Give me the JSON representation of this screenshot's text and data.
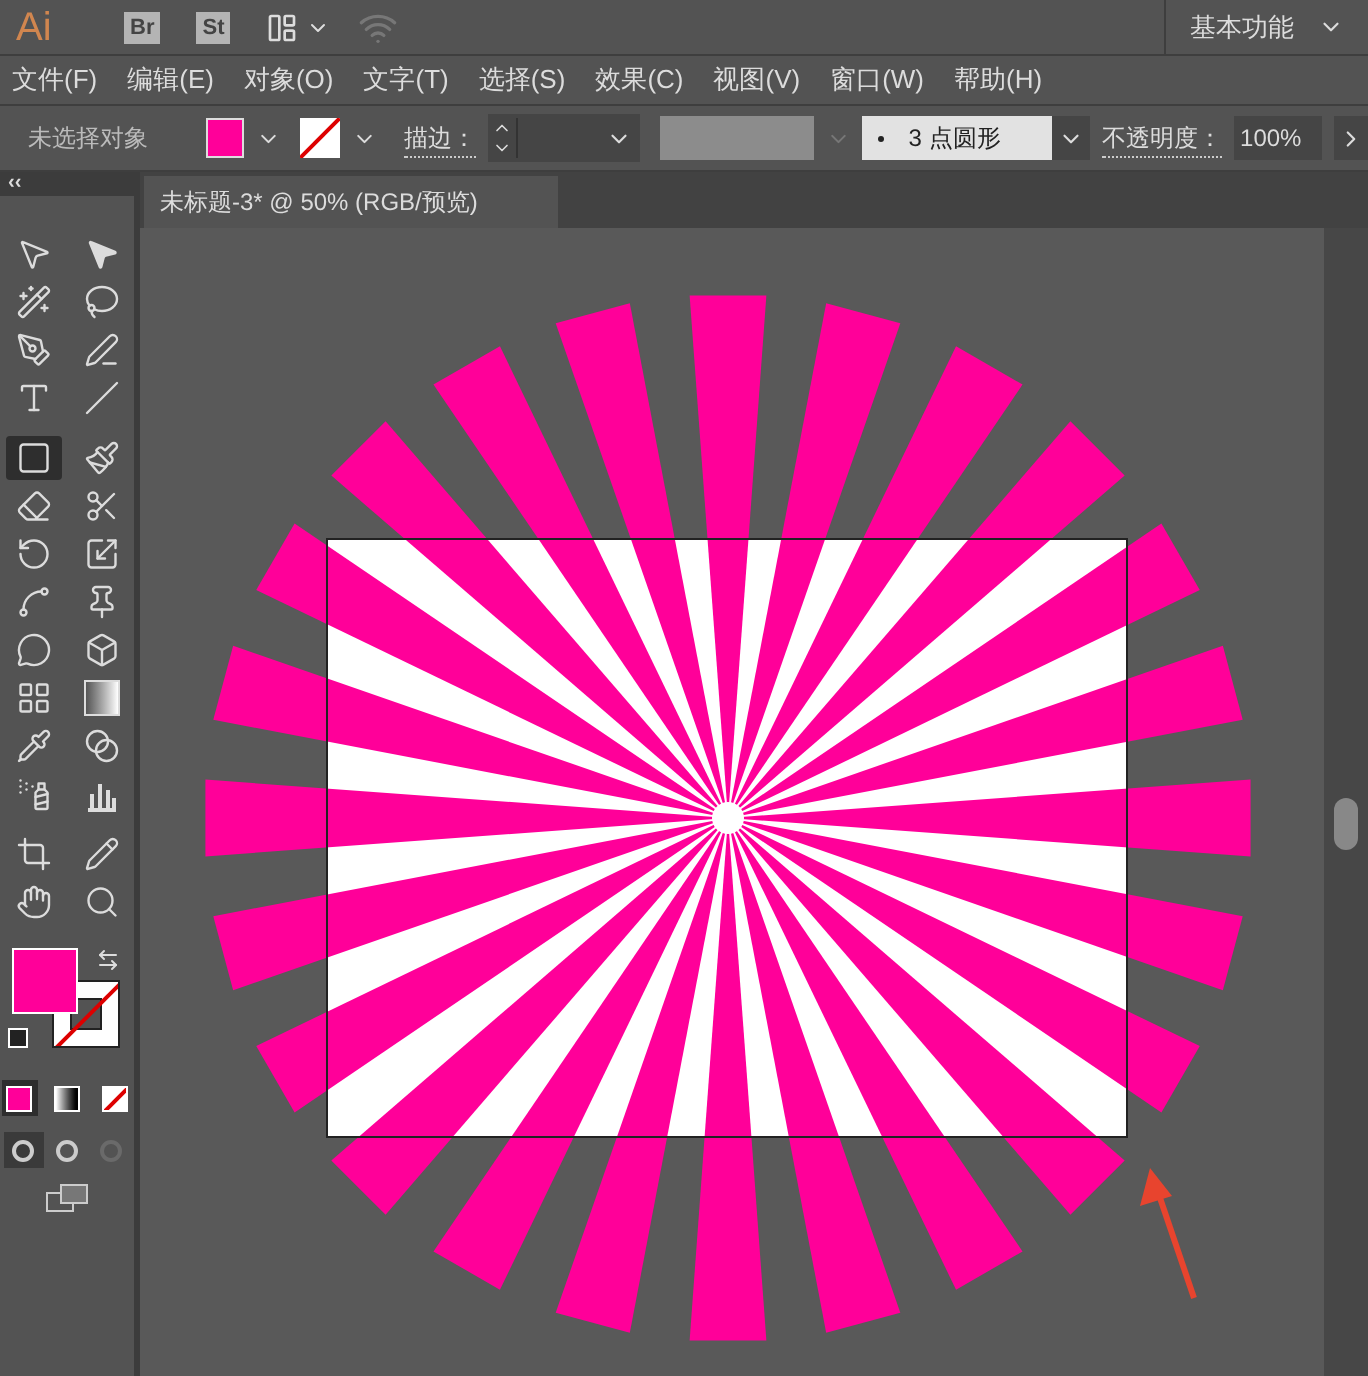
{
  "app": {
    "logo": "Ai",
    "bridge": "Br",
    "stock": "St",
    "workspace": "基本功能"
  },
  "menu": [
    "文件(F)",
    "编辑(E)",
    "对象(O)",
    "文字(T)",
    "选择(S)",
    "效果(C)",
    "视图(V)",
    "窗口(W)",
    "帮助(H)"
  ],
  "control_bar": {
    "selection": "未选择对象",
    "fill": {
      "color": "#ff0099"
    },
    "stroke_label": "描边：",
    "brush": "3 点圆形",
    "opacity_label": "不透明度：",
    "opacity": "100%"
  },
  "panel_collapse": "‹‹",
  "document_tab": {
    "title": "未标题-3* @ 50% (RGB/预览)",
    "selected": true
  },
  "tools": [
    {
      "kind": "select",
      "selected": false
    },
    {
      "kind": "direct-select",
      "selected": false
    },
    {
      "kind": "magic-wand",
      "selected": false
    },
    {
      "kind": "lasso",
      "selected": false
    },
    {
      "kind": "pen",
      "selected": false
    },
    {
      "kind": "curvature",
      "selected": false
    },
    {
      "kind": "type",
      "selected": false
    },
    {
      "kind": "line",
      "selected": false
    },
    {
      "kind": "rectangle",
      "selected": true
    },
    {
      "kind": "paintbrush",
      "selected": false
    },
    {
      "kind": "shaper",
      "selected": false
    },
    {
      "kind": "scissors",
      "selected": false
    },
    {
      "kind": "rotate",
      "selected": false
    },
    {
      "kind": "scale",
      "selected": false
    },
    {
      "kind": "puppet",
      "selected": false
    },
    {
      "kind": "pin",
      "selected": false
    },
    {
      "kind": "free-transform",
      "selected": false
    },
    {
      "kind": "perspective",
      "selected": false
    },
    {
      "kind": "mesh",
      "selected": false
    },
    {
      "kind": "gradient",
      "selected": false
    },
    {
      "kind": "eyedropper",
      "selected": false
    },
    {
      "kind": "blend",
      "selected": false
    },
    {
      "kind": "sprayer",
      "selected": false
    },
    {
      "kind": "graph",
      "selected": false
    },
    {
      "kind": "artboard",
      "selected": false
    },
    {
      "kind": "pencil",
      "selected": false
    },
    {
      "kind": "hand",
      "selected": false
    },
    {
      "kind": "zoom",
      "selected": false
    }
  ],
  "color_modes": [
    {
      "kind": "color",
      "selected": true
    },
    {
      "kind": "gradient",
      "selected": false
    },
    {
      "kind": "none",
      "selected": false
    }
  ],
  "draw_modes": [
    {
      "selected": true,
      "disabled": false
    },
    {
      "selected": false,
      "disabled": false
    },
    {
      "selected": false,
      "disabled": true
    }
  ]
}
